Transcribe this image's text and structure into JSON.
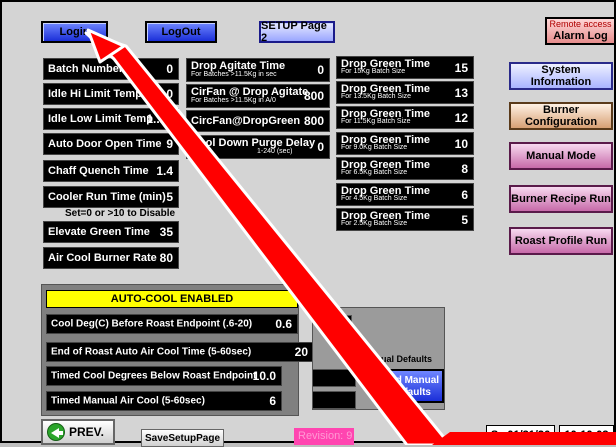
{
  "nav": {
    "login": "Login",
    "logout": "LogOut",
    "setup_page2": "SETUP Page 2"
  },
  "alarm": {
    "remote": "Remote access",
    "label": "Alarm Log"
  },
  "left_params": [
    {
      "label": "Batch Number",
      "value": "0"
    },
    {
      "label": "Idle Hi Limit Temp",
      "value": "240.0"
    },
    {
      "label": "Idle Low Limit Temp",
      "value": "1... 0"
    },
    {
      "label": "Auto Door Open Time",
      "value": "9"
    },
    {
      "label": "Chaff Quench Time",
      "value": "1.4"
    },
    {
      "label": "Cooler Run Time (min)",
      "value": "5"
    },
    {
      "label": "Elevate Green Time",
      "value": "35"
    },
    {
      "label": "Air Cool Burner Rate",
      "value": "80"
    }
  ],
  "cooler_note": "Set=0 or >10 to Disable",
  "mid_params": [
    {
      "label": "Drop Agitate Time",
      "sub": "For Batches >11.5Kg in sec",
      "value": "0"
    },
    {
      "label": "CirFan @ Drop Agitate",
      "sub": "For Batches >11.5Kg in A/0",
      "value": "800"
    },
    {
      "label": "CircFan@DropGreen",
      "sub": "",
      "value": "800"
    },
    {
      "label": "Cool Down Purge Delay",
      "sub": "1-240 (sec)",
      "value": "0"
    }
  ],
  "drop_green": [
    {
      "label": "Drop Green Time",
      "sub": "For 15Kg Batch Size",
      "value": "15"
    },
    {
      "label": "Drop Green Time",
      "sub": "For 13.5Kg Batch Size",
      "value": "13"
    },
    {
      "label": "Drop Green Time",
      "sub": "For 11.5Kg Batch Size",
      "value": "12"
    },
    {
      "label": "Drop Green Time",
      "sub": "For 9.0Kg Batch Size",
      "value": "10"
    },
    {
      "label": "Drop Green Time",
      "sub": "For 6.5Kg Batch Size",
      "value": "8"
    },
    {
      "label": "Drop Green Time",
      "sub": "For 4.5Kg Batch Size",
      "value": "6"
    },
    {
      "label": "Drop Green Time",
      "sub": "For 2.5Kg Batch Size",
      "value": "5"
    }
  ],
  "side_buttons": {
    "system_info": "System Information",
    "burner_config": "Burner Configuration",
    "manual_mode": "Manual Mode",
    "burner_recipe": "Burner Recipe Run",
    "roast_profile": "Roast Profile Run"
  },
  "auto_cool": {
    "banner": "AUTO-COOL ENABLED",
    "rows": [
      {
        "label": "Cool Deg(C) Before Roast Endpoint (.6-20)",
        "value": "0.6"
      },
      {
        "label": "End of Roast Auto Air Cool Time (5-60sec)",
        "value": "20"
      },
      {
        "label": "Timed Cool Degrees Below Roast Endpoint",
        "value": "10.0"
      },
      {
        "label": "Timed Manual Air Cool (5-60sec)",
        "value": "6"
      }
    ],
    "partial_value": "0.6",
    "manual_defaults_label": "Manual Defaults",
    "load_manual_line1": "Load Manual",
    "load_manual_line2": "l Defaults"
  },
  "bottom": {
    "prev": "PREV.",
    "save_setup": "SaveSetupPage",
    "revision": "Revision: 9",
    "date": "Sa 01/31/26",
    "time": "10:10:03"
  },
  "colors": {
    "panel_bg": "#d4d4d4",
    "cell_bg": "#000000",
    "banner_yellow": "#ffff00",
    "arrow_red": "#ff0000",
    "revision_pink": "#ff45b0"
  }
}
